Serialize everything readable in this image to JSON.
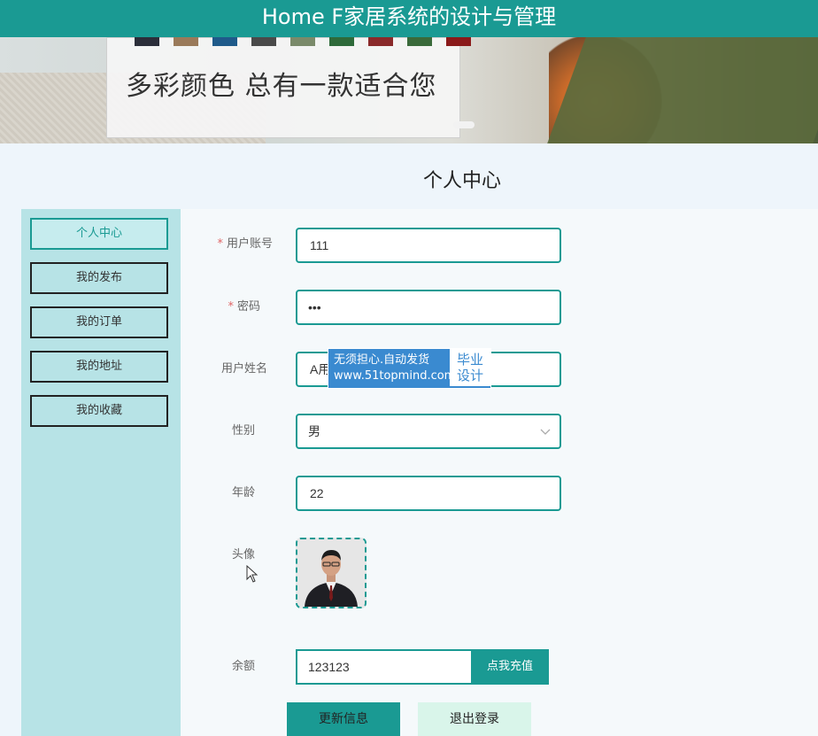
{
  "header": {
    "title": "Home F家居系统的设计与管理"
  },
  "banner": {
    "text": "多彩颜色  总有一款适合您",
    "swatch_colors": [
      "#2b2e3a",
      "#9a7a5a",
      "#1f5a8a",
      "#4a4a4a",
      "#7a8a6a",
      "#2e6a3a",
      "#8a2a2a",
      "#3a6a3a",
      "#8a1a1a"
    ]
  },
  "page_title": "个人中心",
  "sidebar": {
    "items": [
      {
        "label": "个人中心",
        "active": true
      },
      {
        "label": "我的发布",
        "active": false
      },
      {
        "label": "我的订单",
        "active": false
      },
      {
        "label": "我的地址",
        "active": false
      },
      {
        "label": "我的收藏",
        "active": false
      }
    ]
  },
  "form": {
    "account": {
      "label": "用户账号",
      "required": "*",
      "value": "111"
    },
    "password": {
      "label": "密码",
      "required": "*",
      "value": "•••"
    },
    "name": {
      "label": "用户姓名",
      "value": "A用"
    },
    "gender": {
      "label": "性别",
      "value": "男"
    },
    "age": {
      "label": "年龄",
      "value": "22"
    },
    "avatar": {
      "label": "头像"
    },
    "balance": {
      "label": "余额",
      "value": "123123",
      "recharge_label": "点我充值"
    }
  },
  "buttons": {
    "update": "更新信息",
    "logout": "退出登录"
  },
  "watermark": {
    "line1": "无须担心.自动发货",
    "line2": "www.51topmind.com",
    "badge_line1": "毕业",
    "badge_line2": "设计"
  },
  "colors": {
    "primary": "#1a9a93",
    "sidebar_bg": "#b7e3e6",
    "page_bg": "#eef5fb"
  }
}
